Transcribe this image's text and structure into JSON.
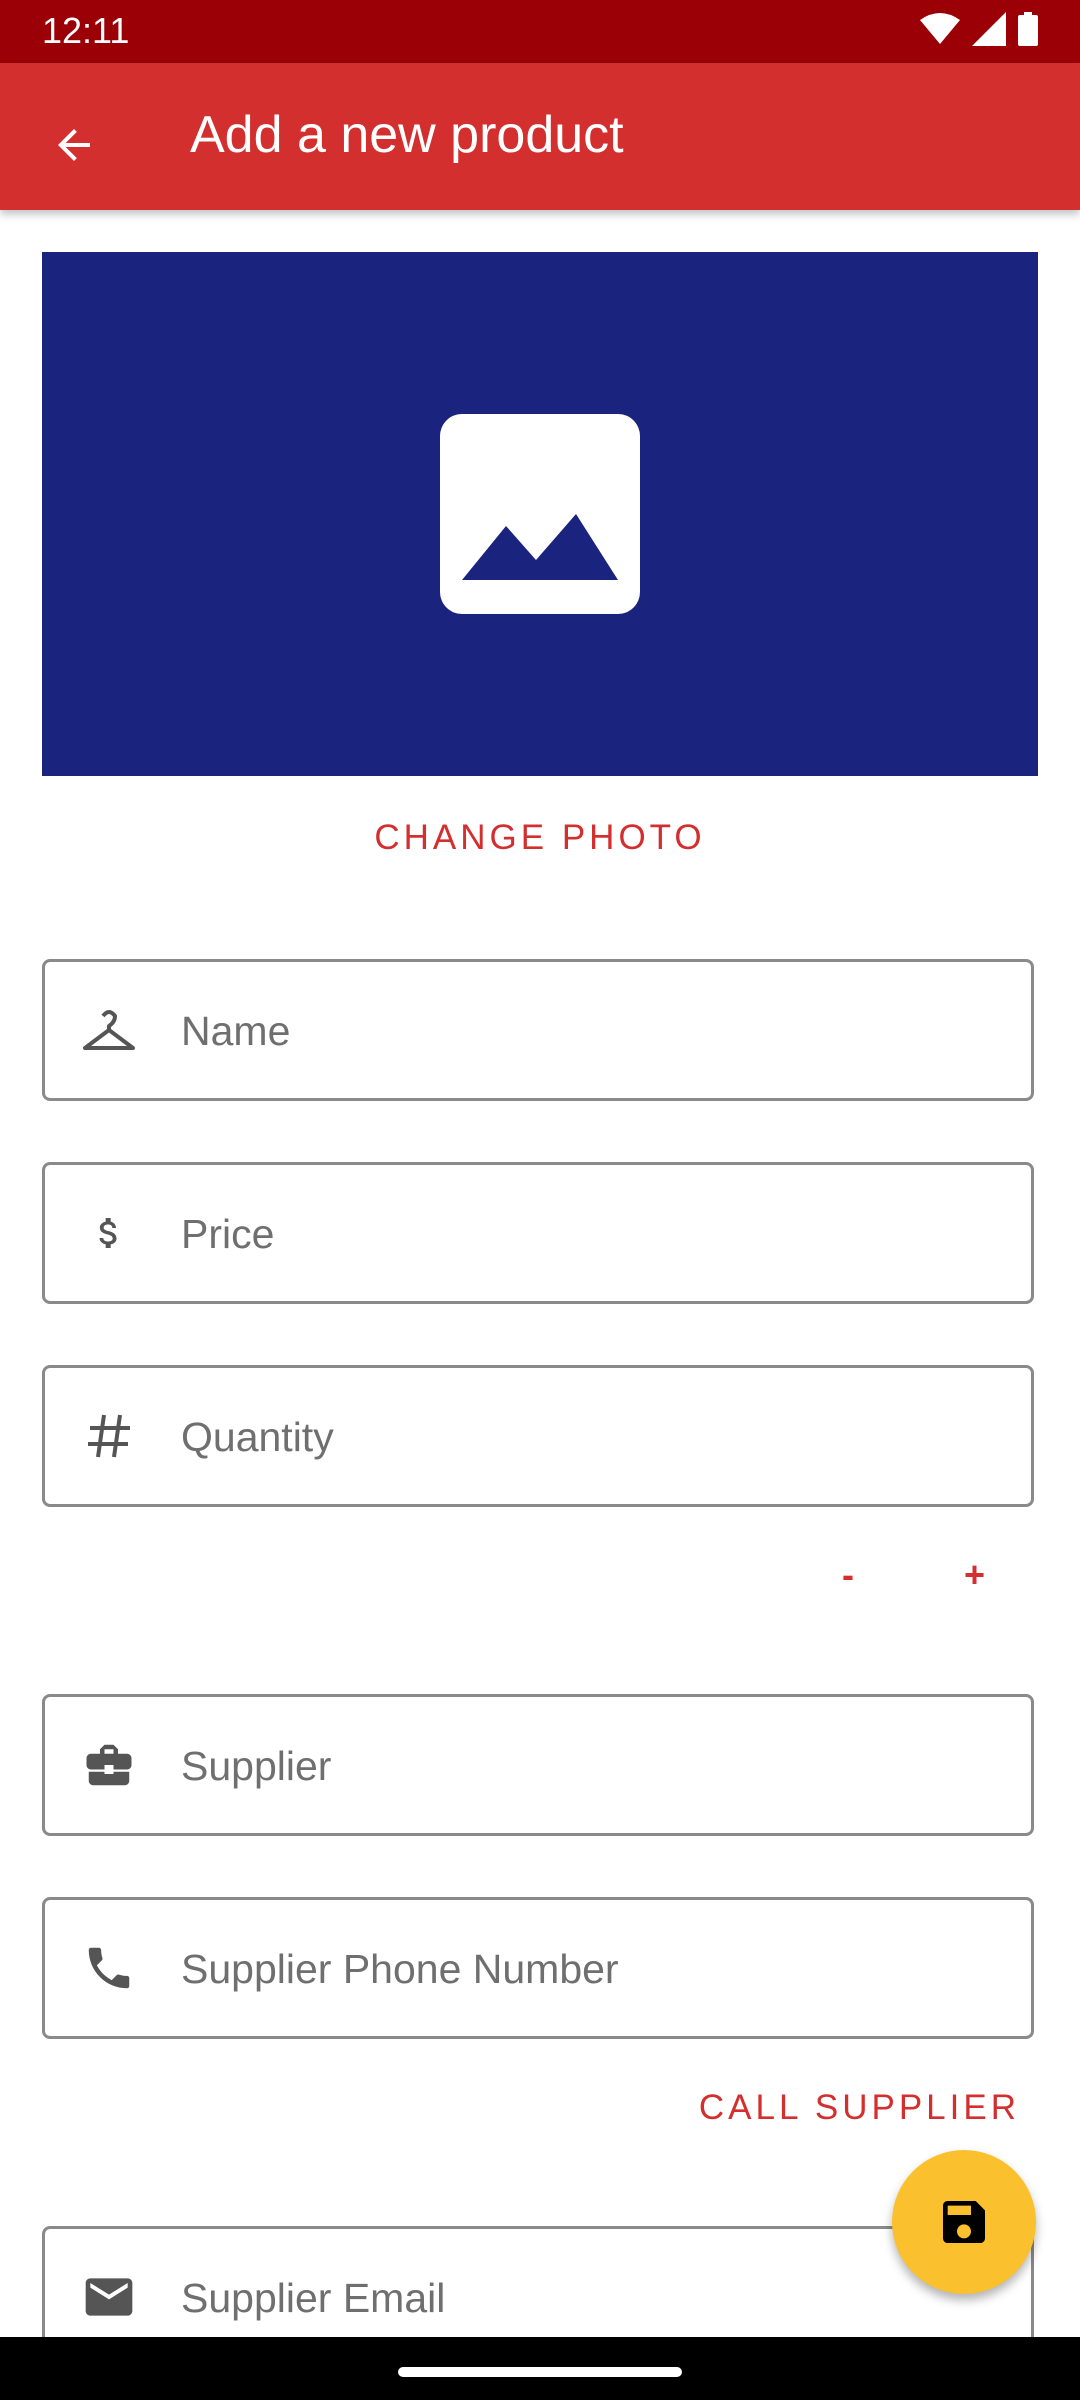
{
  "status_bar": {
    "time": "12:11"
  },
  "app_bar": {
    "title": "Add a new product"
  },
  "photo": {
    "change_label": "CHANGE PHOTO"
  },
  "fields": {
    "name": {
      "placeholder": "Name",
      "icon": "hanger-icon"
    },
    "price": {
      "placeholder": "Price",
      "icon": "dollar-icon"
    },
    "quantity": {
      "placeholder": "Quantity",
      "icon": "hash-icon"
    },
    "supplier": {
      "placeholder": "Supplier",
      "icon": "briefcase-icon"
    },
    "supplier_phone": {
      "placeholder": "Supplier Phone Number",
      "icon": "phone-icon"
    },
    "supplier_email": {
      "placeholder": "Supplier Email",
      "icon": "email-icon"
    }
  },
  "quantity_controls": {
    "decrement": "-",
    "increment": "+"
  },
  "actions": {
    "call_supplier": "CALL SUPPLIER",
    "save_icon": "save-icon"
  },
  "colors": {
    "primary": "#d32f2f",
    "primary_dark": "#9b0007",
    "photo_bg": "#1a237e",
    "fab": "#fbc02d"
  }
}
